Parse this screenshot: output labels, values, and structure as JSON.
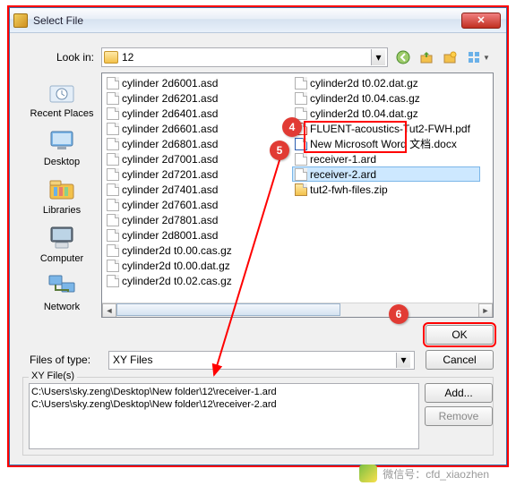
{
  "title": "Select File",
  "lookin": {
    "label": "Look in:",
    "value": "12"
  },
  "places": [
    {
      "label": "Recent Places",
      "key": "recent"
    },
    {
      "label": "Desktop",
      "key": "desktop"
    },
    {
      "label": "Libraries",
      "key": "libraries"
    },
    {
      "label": "Computer",
      "key": "computer"
    },
    {
      "label": "Network",
      "key": "network"
    }
  ],
  "files_col1": [
    "cylinder 2d6001.asd",
    "cylinder 2d6201.asd",
    "cylinder 2d6401.asd",
    "cylinder 2d6601.asd",
    "cylinder 2d6801.asd",
    "cylinder 2d7001.asd",
    "cylinder 2d7201.asd",
    "cylinder 2d7401.asd",
    "cylinder 2d7601.asd",
    "cylinder 2d7801.asd",
    "cylinder 2d8001.asd",
    "cylinder2d t0.00.cas.gz",
    "cylinder2d t0.00.dat.gz",
    "cylinder2d t0.02.cas.gz",
    "cylinder2d t0.02.dat.gz"
  ],
  "files_col2": [
    {
      "name": "cylinder2d t0.04.cas.gz",
      "type": "file"
    },
    {
      "name": "cylinder2d t0.04.dat.gz",
      "type": "file"
    },
    {
      "name": "FLUENT-acoustics-Tut2-FWH.pdf",
      "type": "pdf"
    },
    {
      "name": "New Microsoft Word 文档.docx",
      "type": "docx"
    },
    {
      "name": "receiver-1.ard",
      "type": "file"
    },
    {
      "name": "receiver-2.ard",
      "type": "file",
      "selected": true
    },
    {
      "name": "tut2-fwh-files.zip",
      "type": "zip"
    }
  ],
  "filter": {
    "label": "Files of type:",
    "value": "XY Files"
  },
  "buttons": {
    "ok": "OK",
    "cancel": "Cancel",
    "add": "Add...",
    "remove": "Remove"
  },
  "xy": {
    "legend": "XY File(s)",
    "paths": [
      "C:\\Users\\sky.zeng\\Desktop\\New folder\\12\\receiver-1.ard",
      "C:\\Users\\sky.zeng\\Desktop\\New folder\\12\\receiver-2.ard"
    ]
  },
  "callouts": {
    "c4": "4",
    "c5": "5",
    "c6": "6"
  },
  "watermark": "微信号：cfd_xiaozhen"
}
